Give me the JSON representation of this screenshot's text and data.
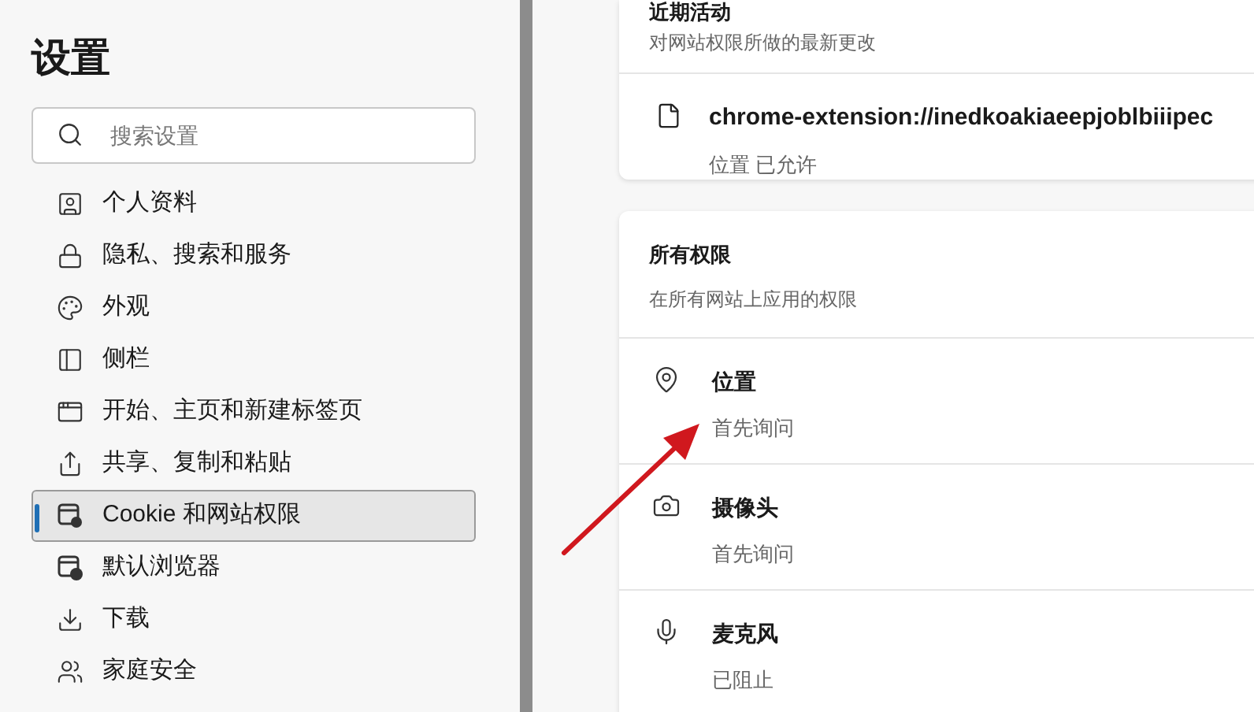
{
  "sidebar": {
    "title": "设置",
    "search": {
      "placeholder": "搜索设置"
    },
    "items": [
      {
        "label": "个人资料",
        "selected": false
      },
      {
        "label": "隐私、搜索和服务",
        "selected": false
      },
      {
        "label": "外观",
        "selected": false
      },
      {
        "label": "侧栏",
        "selected": false
      },
      {
        "label": "开始、主页和新建标签页",
        "selected": false
      },
      {
        "label": "共享、复制和粘贴",
        "selected": false
      },
      {
        "label": "Cookie 和网站权限",
        "selected": true
      },
      {
        "label": "默认浏览器",
        "selected": false
      },
      {
        "label": "下载",
        "selected": false
      },
      {
        "label": "家庭安全",
        "selected": false
      }
    ]
  },
  "recent": {
    "title": "近期活动",
    "subtitle": "对网站权限所做的最新更改",
    "items": [
      {
        "site": "chrome-extension://inedkoakiaeepjoblbiiipec",
        "detail": "位置 已允许"
      }
    ]
  },
  "all_permissions": {
    "title": "所有权限",
    "subtitle": "在所有网站上应用的权限",
    "items": [
      {
        "label": "位置",
        "status": "首先询问"
      },
      {
        "label": "摄像头",
        "status": "首先询问"
      },
      {
        "label": "麦克风",
        "status": "已阻止"
      }
    ]
  }
}
